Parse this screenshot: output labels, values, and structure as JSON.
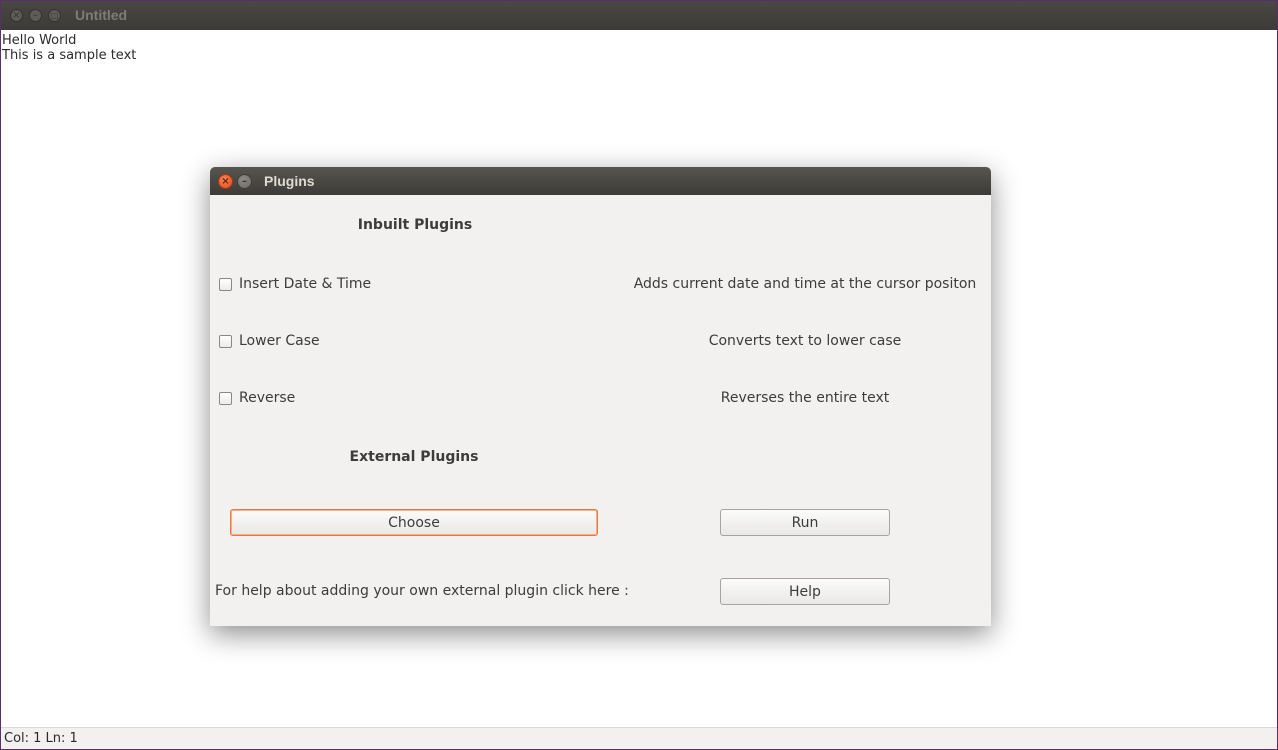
{
  "main_window": {
    "title": "Untitled",
    "editor_lines": [
      "Hello World",
      "This is a sample text"
    ],
    "status": "Col: 1 Ln: 1",
    "buttons": {
      "close_icon": "×",
      "minimize_icon": "–",
      "maximize_icon": "□"
    }
  },
  "dialog": {
    "title": "Plugins",
    "close_icon": "×",
    "minimize_icon": "–",
    "inbuilt_heading": "Inbuilt Plugins",
    "plugins": [
      {
        "label": "Insert Date & Time",
        "description": "Adds current date and time at the cursor positon",
        "checked": false
      },
      {
        "label": "Lower Case",
        "description": "Converts text to lower case",
        "checked": false
      },
      {
        "label": "Reverse",
        "description": "Reverses the entire text",
        "checked": false
      }
    ],
    "external_heading": "External Plugins",
    "choose_label": "Choose",
    "run_label": "Run",
    "help_text": "For help about adding your own external plugin click here :",
    "help_label": "Help"
  },
  "colors": {
    "accent_focus": "#e07a3e",
    "close_button": "#df4a16",
    "titlebar": "#3c3b37",
    "dialog_bg": "#f2f1f0"
  }
}
